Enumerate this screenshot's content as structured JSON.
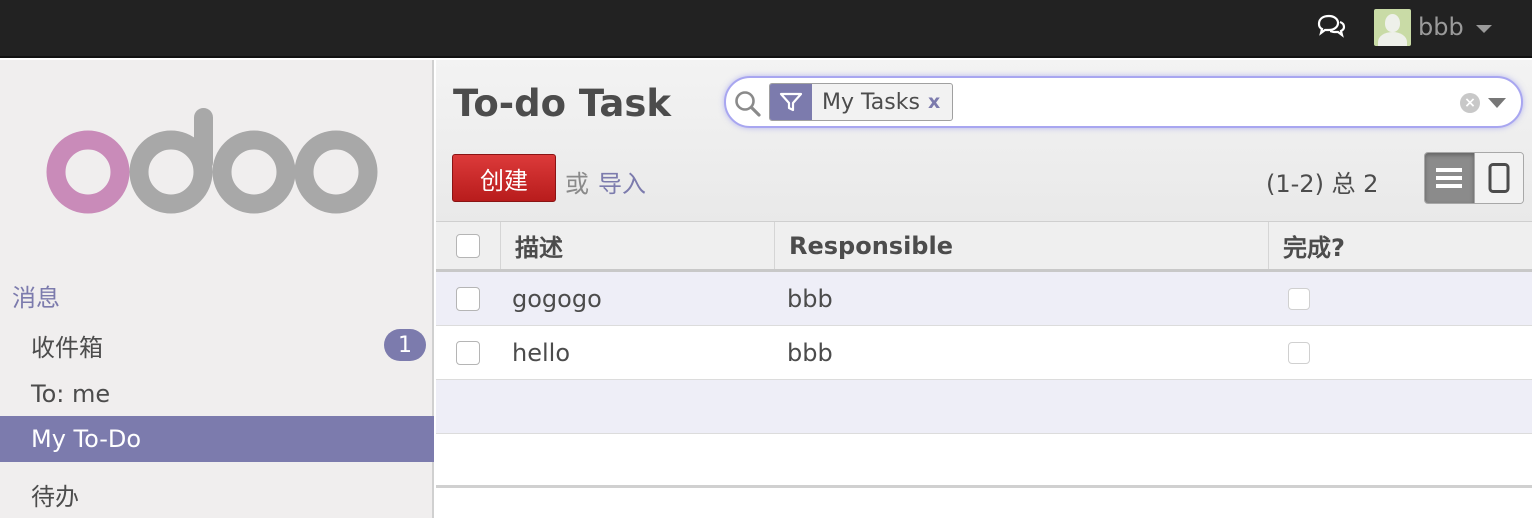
{
  "topbar": {
    "chat_icon": "chat-bubbles-icon",
    "user_name": "bbb",
    "avatar_icon": "user-avatar-icon"
  },
  "sidebar": {
    "logo_text": "odoo",
    "section_header": "消息",
    "items": [
      {
        "label": "收件箱",
        "badge": "1",
        "active": false
      },
      {
        "label": "To: me",
        "active": false
      },
      {
        "label": "My To-Do",
        "active": true
      },
      {
        "label": "待办",
        "active": false
      }
    ]
  },
  "control_panel": {
    "title": "To-do Task",
    "search": {
      "facet_icon": "filter-icon",
      "facet_label": "My Tasks",
      "facet_remove": "x"
    },
    "create_label": "创建",
    "or_label": "或",
    "import_label": "导入",
    "pager": "(1-2) 总 2",
    "views": [
      "list-view-icon",
      "kanban-view-icon"
    ]
  },
  "table": {
    "columns": [
      "描述",
      "Responsible",
      "完成?"
    ],
    "rows": [
      {
        "description": "gogogo",
        "responsible": "bbb",
        "done": false
      },
      {
        "description": "hello",
        "responsible": "bbb",
        "done": false
      }
    ]
  },
  "colors": {
    "accent": "#7c7bad",
    "create_button": "#c62828",
    "topbar": "#222222"
  }
}
